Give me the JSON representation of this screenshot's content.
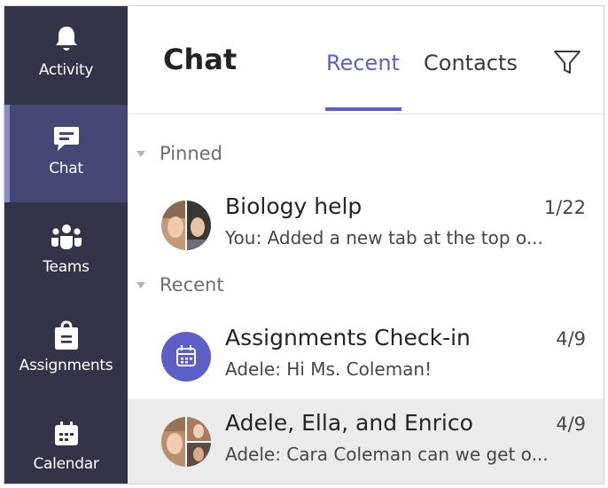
{
  "rail": {
    "items": [
      {
        "label": "Activity",
        "icon": "bell-icon"
      },
      {
        "label": "Chat",
        "icon": "chat-icon"
      },
      {
        "label": "Teams",
        "icon": "teams-icon"
      },
      {
        "label": "Assignments",
        "icon": "assignments-icon"
      },
      {
        "label": "Calendar",
        "icon": "calendar-icon"
      }
    ]
  },
  "header": {
    "title": "Chat",
    "tabs": [
      {
        "label": "Recent",
        "active": true
      },
      {
        "label": "Contacts",
        "active": false
      }
    ],
    "filter_icon": "filter-icon"
  },
  "sections": {
    "pinned": {
      "label": "Pinned",
      "items": [
        {
          "name": "Biology help",
          "date": "1/22",
          "preview": "You: Added a new tab at the top o..."
        }
      ]
    },
    "recent": {
      "label": "Recent",
      "items": [
        {
          "name": "Assignments Check-in",
          "date": "4/9",
          "preview": "Adele: Hi Ms. Coleman!"
        },
        {
          "name": "Adele, Ella, and Enrico",
          "date": "4/9",
          "preview": "Adele: Cara Coleman can we get o..."
        }
      ]
    }
  },
  "colors": {
    "rail_bg": "#33344a",
    "rail_active_bg": "#464775",
    "accent": "#5b5fc7",
    "selected_row": "#ebebeb"
  }
}
